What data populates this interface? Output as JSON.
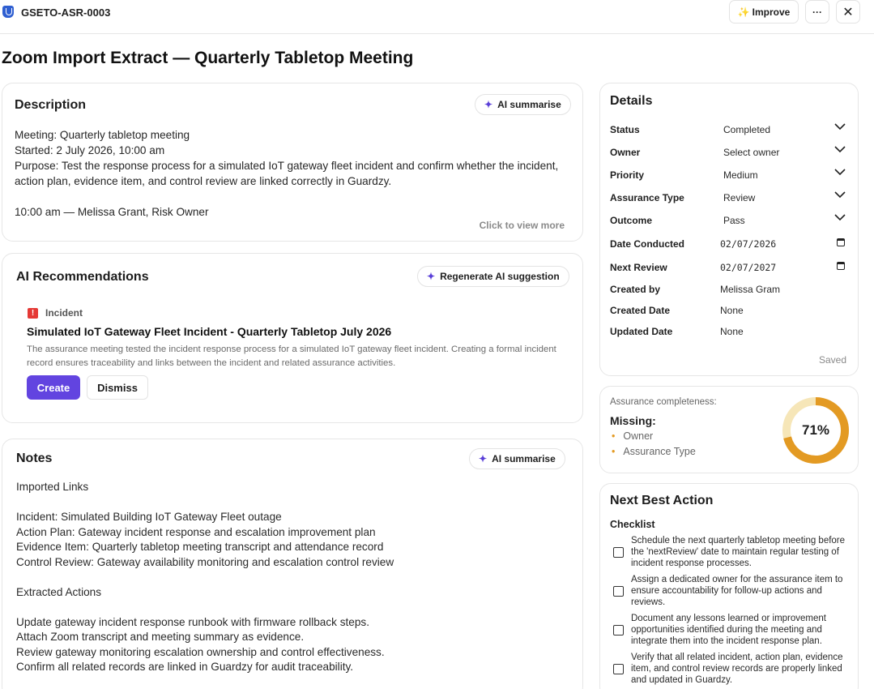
{
  "header": {
    "record_id": "GSETO-ASR-0003",
    "improve_label": "Improve",
    "more_label": "···",
    "close_label": "✕"
  },
  "page": {
    "title": "Zoom Import Extract — Quarterly Tabletop Meeting"
  },
  "description": {
    "title": "Description",
    "ai_button": "AI summarise",
    "lines": [
      "Meeting: Quarterly tabletop meeting",
      "Started: 2 July 2026, 10:00 am",
      "Purpose: Test the response process for a simulated IoT gateway fleet incident and confirm whether the incident, action plan, evidence item, and control review are linked correctly in Guardzy.",
      "",
      "10:00 am — Melissa Grant, Risk Owner"
    ],
    "view_more": "Click to view more"
  },
  "ai_recommendations": {
    "title": "AI Recommendations",
    "regenerate_button": "Regenerate AI suggestion",
    "item": {
      "type": "Incident",
      "title": "Simulated IoT Gateway Fleet Incident - Quarterly Tabletop July 2026",
      "description": "The assurance meeting tested the incident response process for a simulated IoT gateway fleet incident. Creating a formal incident record ensures traceability and links between the incident and related assurance activities.",
      "create_label": "Create",
      "dismiss_label": "Dismiss"
    }
  },
  "notes": {
    "title": "Notes",
    "ai_button": "AI summarise",
    "lines": [
      "Imported Links",
      "",
      "Incident: Simulated Building IoT Gateway Fleet outage",
      "Action Plan: Gateway incident response and escalation improvement plan",
      "Evidence Item: Quarterly tabletop meeting transcript and attendance record",
      "Control Review: Gateway availability monitoring and escalation control review",
      "",
      "Extracted Actions",
      "",
      "Update gateway incident response runbook with firmware rollback steps.",
      "Attach Zoom transcript and meeting summary as evidence.",
      "Review gateway monitoring escalation ownership and control effectiveness.",
      "Confirm all related records are linked in Guardzy for audit traceability."
    ]
  },
  "details": {
    "title": "Details",
    "fields": [
      {
        "label": "Status",
        "value": "Completed",
        "control": "select"
      },
      {
        "label": "Owner",
        "value": "Select owner",
        "control": "select"
      },
      {
        "label": "Priority",
        "value": "Medium",
        "control": "select"
      },
      {
        "label": "Assurance Type",
        "value": "Review",
        "control": "select"
      },
      {
        "label": "Outcome",
        "value": "Pass",
        "control": "select"
      },
      {
        "label": "Date Conducted",
        "value": "02/07/2026",
        "control": "date"
      },
      {
        "label": "Next Review",
        "value": "02/07/2027",
        "control": "date"
      },
      {
        "label": "Created by",
        "value": "Melissa Gram",
        "control": "text"
      },
      {
        "label": "Created Date",
        "value": "None",
        "control": "text"
      },
      {
        "label": "Updated Date",
        "value": "None",
        "control": "text"
      }
    ],
    "saved_label": "Saved"
  },
  "completeness": {
    "label": "Assurance completeness:",
    "missing_title": "Missing:",
    "missing_items": [
      "Owner",
      "Assurance Type"
    ],
    "percent": 71,
    "percent_label": "71%",
    "colors": {
      "fill": "#e39a23",
      "track": "#f6e6b8"
    }
  },
  "next_best_action": {
    "title": "Next Best Action",
    "checklist_title": "Checklist",
    "items": [
      "Schedule the next quarterly tabletop meeting before the 'nextReview' date to maintain regular testing of incident response processes.",
      "Assign a dedicated owner for the assurance item to ensure accountability for follow-up actions and reviews.",
      "Document any lessons learned or improvement opportunities identified during the meeting and integrate them into the incident response plan.",
      "Verify that all related incident, action plan, evidence item, and control review records are properly linked and updated in Guardzy."
    ]
  },
  "colors": {
    "accent": "#6244e0",
    "warning": "#e53935",
    "border": "#e6e6e6"
  }
}
